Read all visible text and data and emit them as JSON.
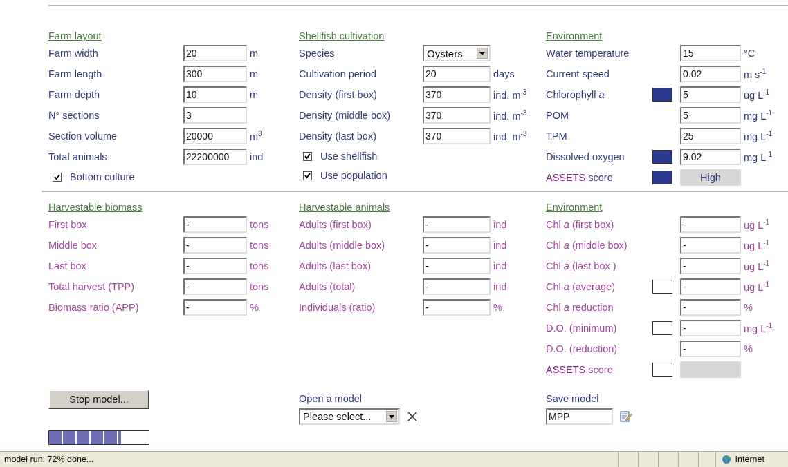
{
  "input_panel": {
    "columns": [
      {
        "heading": "Farm layout",
        "rows": [
          {
            "kind": "input",
            "label": "Farm width",
            "value": "20",
            "unit": "m"
          },
          {
            "kind": "input",
            "label": "Farm length",
            "value": "300",
            "unit": "m"
          },
          {
            "kind": "input",
            "label": "Farm depth",
            "value": "10",
            "unit": "m"
          },
          {
            "kind": "input",
            "label": "N° sections",
            "value": "3"
          },
          {
            "kind": "input",
            "label": "Section volume",
            "value": "20000",
            "unit": "m$^{3}$"
          },
          {
            "kind": "input",
            "label": "Total animals",
            "value": "22200000",
            "unit": "ind"
          }
        ],
        "checkboxes": [
          {
            "label": "Bottom culture",
            "checked": true
          }
        ]
      },
      {
        "heading": "Shellfish cultivation",
        "rows": [
          {
            "kind": "select",
            "label": "Species",
            "value": "Oysters"
          },
          {
            "kind": "input",
            "label": "Cultivation period",
            "value": "20",
            "unit": "days"
          },
          {
            "kind": "input",
            "label": "Density (first box)",
            "value": "370",
            "unit": "ind. m$^{-3}$"
          },
          {
            "kind": "input",
            "label": "Density (middle box)",
            "value": "370",
            "unit": "ind. m$^{-3}$"
          },
          {
            "kind": "input",
            "label": "Density (last box)",
            "value": "370",
            "unit": "ind. m$^{-3}$"
          }
        ],
        "checkboxes": [
          {
            "label": "Use shellfish",
            "checked": true
          },
          {
            "label": "Use population",
            "checked": true
          }
        ]
      },
      {
        "heading": "Environment",
        "rows": [
          {
            "kind": "input",
            "label": "Water temperature",
            "value": "15",
            "unit": "°C"
          },
          {
            "kind": "input",
            "label": "Current speed",
            "value": "0.02",
            "unit": "m s$^{-1}$"
          },
          {
            "kind": "input",
            "label": "Chlorophyll *a*",
            "value": "5",
            "unit": "ug L$^{-1}$",
            "indicator": {
              "color": "#2b3a8f"
            }
          },
          {
            "kind": "input",
            "label": "POM",
            "value": "5",
            "unit": "mg L$^{-1}$"
          },
          {
            "kind": "input",
            "label": "TPM",
            "value": "25",
            "unit": "mg L$^{-1}$"
          },
          {
            "kind": "input",
            "label": "Dissolved oxygen",
            "value": "9.02",
            "unit": "mg L$^{-1}$",
            "indicator": {
              "color": "#2b3a8f"
            }
          },
          {
            "kind": "score",
            "link": "ASSETS",
            "label": "score",
            "value": "High",
            "indicator": {
              "color": "#2b3a8f"
            }
          }
        ]
      }
    ]
  },
  "results_panel": {
    "columns": [
      {
        "heading": "Harvestable biomass",
        "rows": [
          {
            "kind": "input",
            "label": "First box",
            "value": "-",
            "unit": "tons"
          },
          {
            "kind": "input",
            "label": "Middle box",
            "value": "-",
            "unit": "tons"
          },
          {
            "kind": "input",
            "label": "Last box",
            "value": "-",
            "unit": "tons"
          },
          {
            "kind": "input",
            "label": "Total harvest (TPP)",
            "value": "-",
            "unit": "tons"
          },
          {
            "kind": "input",
            "label": "Biomass ratio (APP)",
            "value": "-",
            "unit": "%"
          }
        ]
      },
      {
        "heading": "Harvestable animals",
        "rows": [
          {
            "kind": "input",
            "label": "Adults (first box)",
            "value": "-",
            "unit": "ind"
          },
          {
            "kind": "input",
            "label": "Adults (middle box)",
            "value": "-",
            "unit": "ind"
          },
          {
            "kind": "input",
            "label": "Adults (last box)",
            "value": "-",
            "unit": "ind"
          },
          {
            "kind": "input",
            "label": "Adults (total)",
            "value": "-",
            "unit": "ind"
          },
          {
            "kind": "input",
            "label": "Individuals (ratio)",
            "value": "-",
            "unit": "%"
          }
        ]
      },
      {
        "heading": "Environment",
        "rows": [
          {
            "kind": "input",
            "label": "Chl *a* (first box)",
            "value": "-",
            "unit": "ug L$^{-1}$"
          },
          {
            "kind": "input",
            "label": "Chl *a* (middle box)",
            "value": "-",
            "unit": "ug L$^{-1}$"
          },
          {
            "kind": "input",
            "label": "Chl *a* (last box )",
            "value": "-",
            "unit": "ug L$^{-1}$"
          },
          {
            "kind": "input",
            "label": "Chl *a* (average)",
            "value": "-",
            "unit": "ug L$^{-1}$",
            "indicator": {
              "color": "#ffffff"
            }
          },
          {
            "kind": "input",
            "label": "Chl *a* reduction",
            "value": "-",
            "unit": "%"
          },
          {
            "kind": "input",
            "label": "D.O. (minimum)",
            "value": "-",
            "unit": "mg L$^{-1}$",
            "indicator": {
              "color": "#ffffff"
            }
          },
          {
            "kind": "input",
            "label": "D.O. (reduction)",
            "value": "-",
            "unit": "%"
          },
          {
            "kind": "score",
            "link": "ASSETS",
            "label": "score",
            "indicator": {
              "color": "#ffffff"
            }
          }
        ]
      }
    ]
  },
  "footer": {
    "stop_button": "Stop model...",
    "progress": {
      "level": 0.72
    },
    "open": {
      "label": "Open a model",
      "value": "Please select..."
    },
    "save": {
      "label": "Save model",
      "value": "MPP"
    }
  },
  "status_bar": {
    "text": "model run: 72% done...",
    "zone": "Internet"
  }
}
